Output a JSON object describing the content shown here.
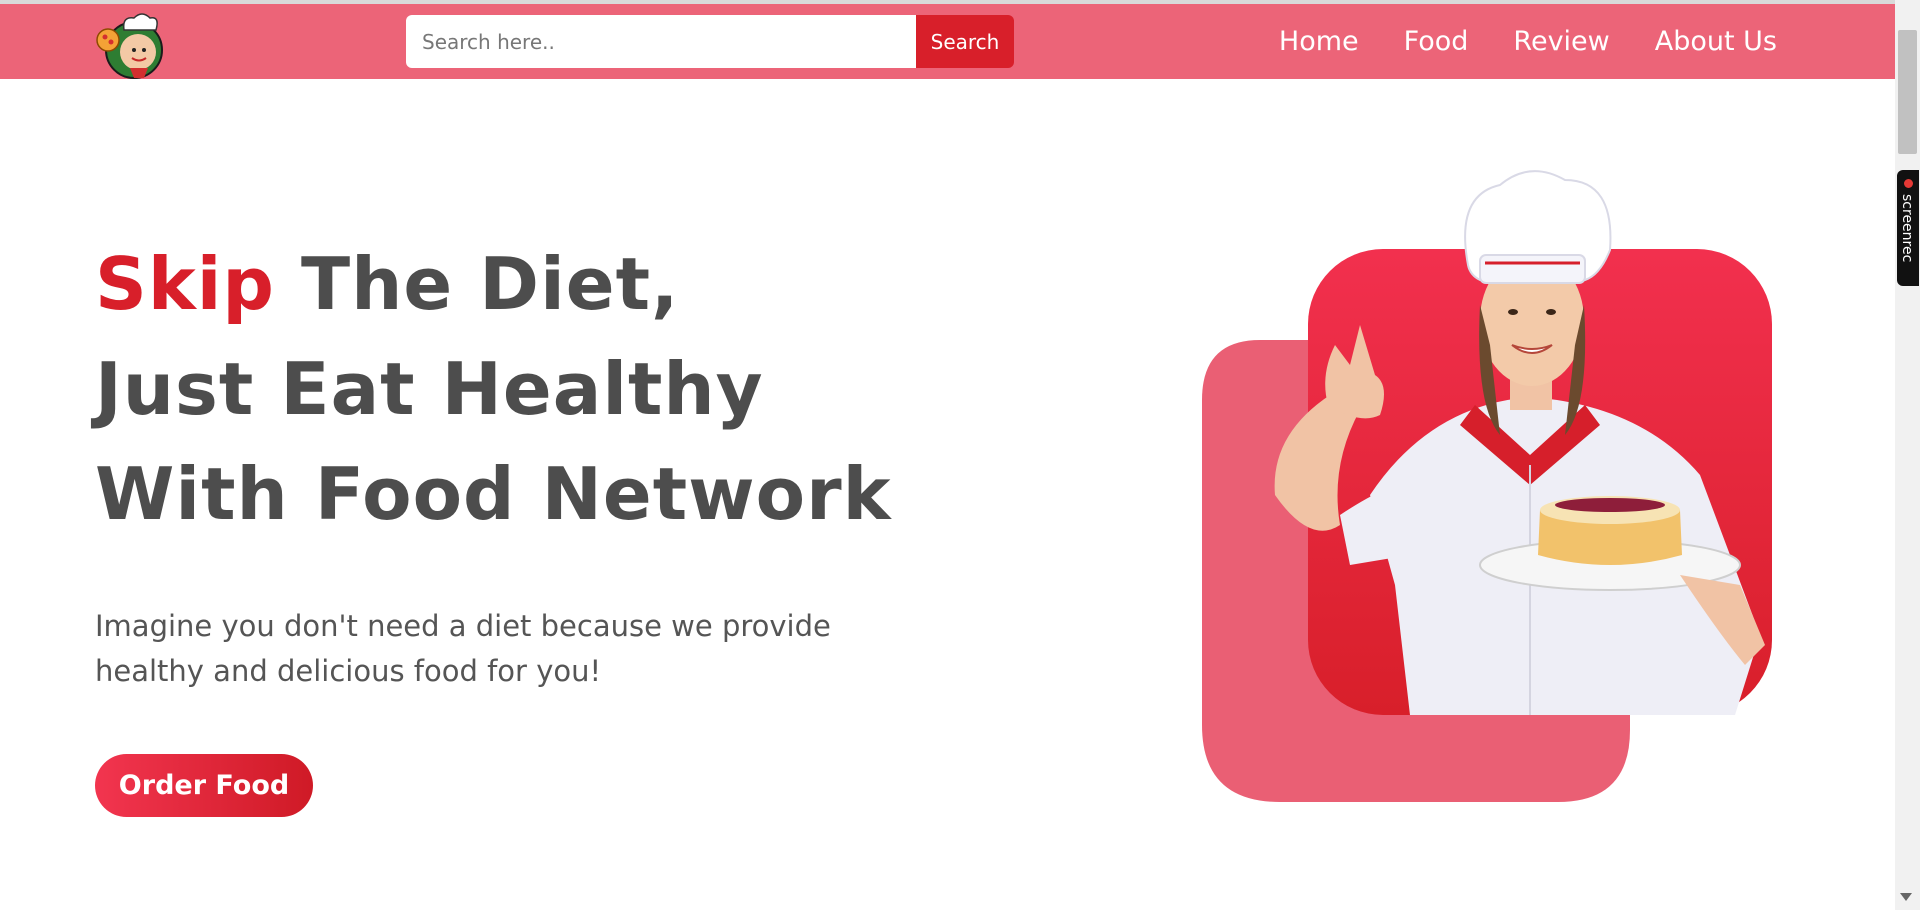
{
  "navbar": {
    "logo_name": "chef-logo",
    "search": {
      "placeholder": "Search here..",
      "value": "",
      "button_label": "Search"
    },
    "links": [
      "Home",
      "Food",
      "Review",
      "About Us"
    ]
  },
  "hero": {
    "title_accent": "Skip",
    "title_line1_rest": " The Diet,",
    "title_line2": "Just Eat Healthy",
    "title_line3": "With Food Network",
    "description": "Imagine you don't need a diet because we provide healthy and delicious food for you!",
    "cta_label": "Order Food"
  },
  "overlay": {
    "recorder_label": "screenrec"
  },
  "colors": {
    "nav_bg": "#ec6478",
    "accent_red": "#d81f2a",
    "text_dark": "#4d4d4d",
    "shape_back": "#ea5f74",
    "shape_front": "#e02538"
  }
}
